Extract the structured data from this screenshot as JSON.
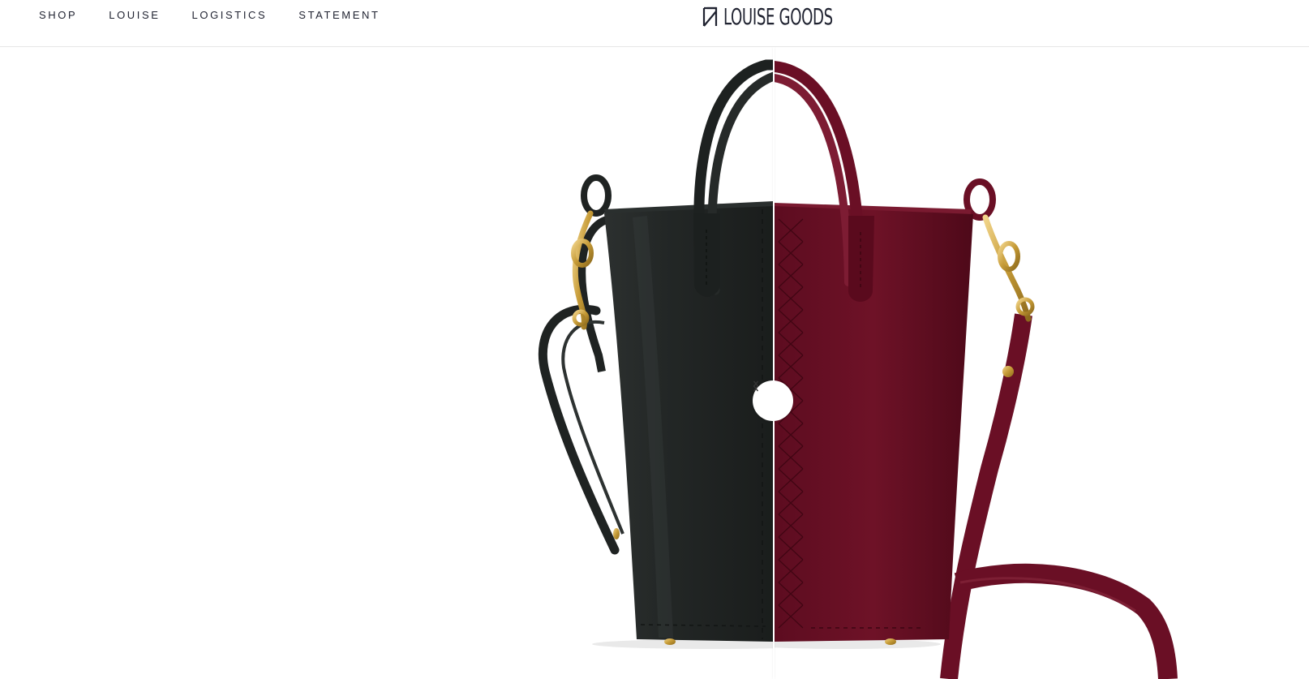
{
  "nav": {
    "items": [
      {
        "label": "SHOP"
      },
      {
        "label": "LOUISE"
      },
      {
        "label": "LOGISTICS"
      },
      {
        "label": "STATEMENT"
      }
    ]
  },
  "brand": {
    "name": "LOUISE GOODS"
  },
  "comparison": {
    "left_color_name": "black",
    "right_color_name": "burgundy",
    "slider_position_percent": 59,
    "handle_icons": [
      "chevron-left-icon",
      "chevron-right-icon"
    ]
  },
  "colors": {
    "text": "#1f2230",
    "black_leather": "#1f2322",
    "burgundy_leather": "#6a0f25",
    "brass": "#c9a445"
  }
}
